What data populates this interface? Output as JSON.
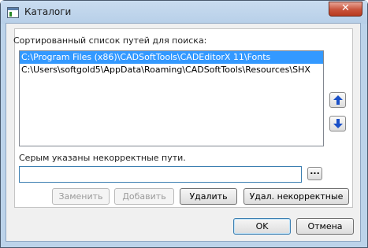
{
  "window": {
    "title": "Каталоги",
    "close_symbol": "✕",
    "icon": "window-app-icon"
  },
  "paths": {
    "label": "Сортированный список путей для поиска:",
    "items": [
      "C:\\Program Files (x86)\\CADSoftTools\\CADEditorX 11\\Fonts",
      "C:\\Users\\softgold5\\AppData\\Roaming\\CADSoftTools\\Resources\\SHX"
    ],
    "selected_index": 0
  },
  "move": {
    "up_icon": "arrow-up-icon",
    "down_icon": "arrow-down-icon"
  },
  "hint": {
    "label": "Серым указаны некорректные пути."
  },
  "input": {
    "value": "",
    "browse_label": "..."
  },
  "actions": {
    "replace": "Заменить",
    "add": "Добавить",
    "delete": "Удалить",
    "delete_invalid": "Удал. некорректные"
  },
  "footer": {
    "ok": "OK",
    "cancel": "Отмена"
  },
  "colors": {
    "selection": "#3399ff",
    "arrow": "#1a50c8",
    "close": "#c8533b"
  }
}
